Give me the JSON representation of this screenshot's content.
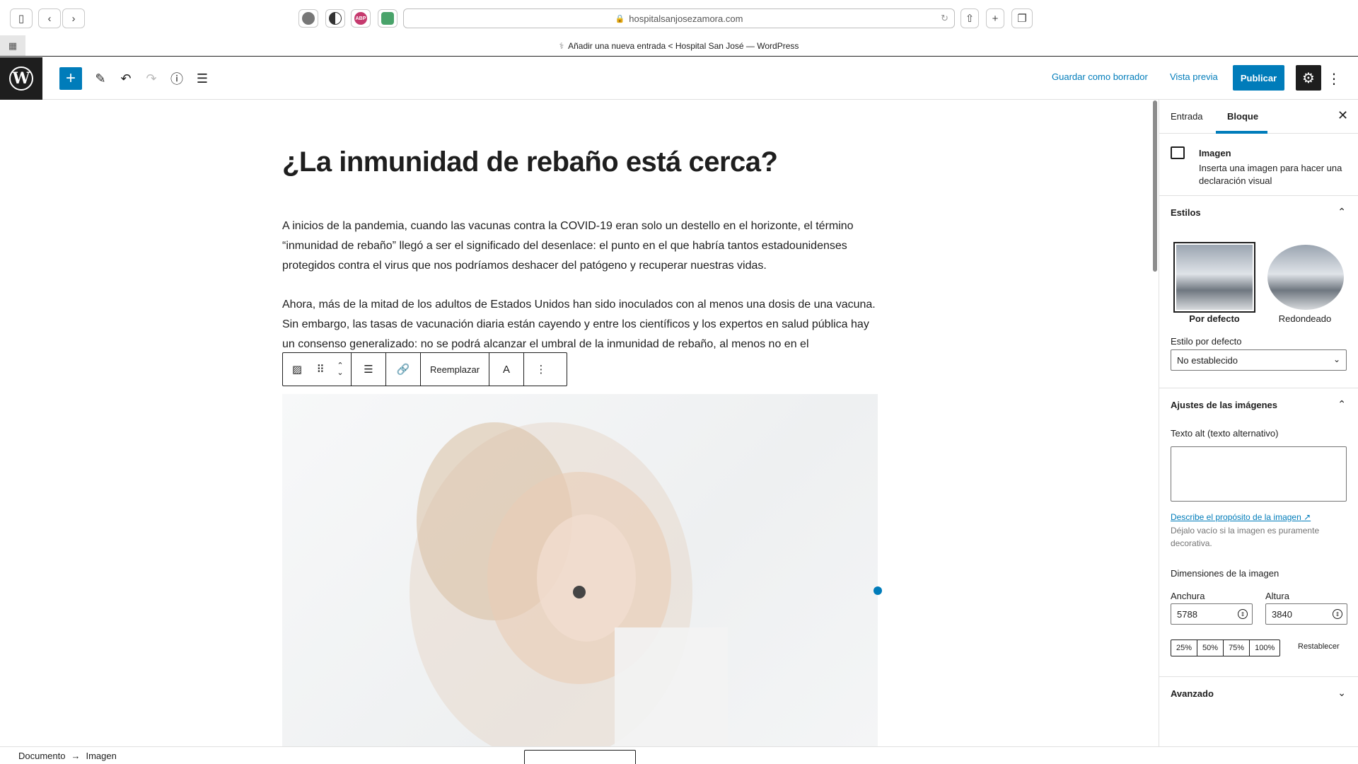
{
  "browser": {
    "url": "hospitalsanjosezamora.com",
    "tab_title": "Añadir una nueva entrada < Hospital San José — WordPress",
    "ext_abp_label": "ABP"
  },
  "header": {
    "save_draft": "Guardar como borrador",
    "preview": "Vista previa",
    "publish": "Publicar"
  },
  "post": {
    "title": "¿La inmunidad de rebaño está cerca?",
    "paragraph1": "A inicios de la pandemia, cuando las vacunas contra la COVID-19 eran solo un destello en el horizonte, el término “inmunidad de rebaño” llegó a ser el significado del desenlace: el punto en el que habría tantos estadounidenses protegidos contra el virus que nos podríamos deshacer del patógeno y recuperar nuestras vidas.",
    "paragraph2": "Ahora, más de la mitad de los adultos de Estados Unidos han sido inoculados con al menos una dosis de una vacuna. Sin embargo, las tasas de vacunación diaria están cayendo y entre los científicos y los expertos en salud pública hay un consenso generalizado: no se podrá alcanzar el umbral de la inmunidad de rebaño, al menos no en el"
  },
  "block_toolbar": {
    "replace": "Reemplazar",
    "text_letter": "A"
  },
  "sidebar": {
    "tab_post": "Entrada",
    "tab_block": "Bloque",
    "block_name": "Imagen",
    "block_desc": "Inserta una imagen para hacer una declaración visual",
    "styles_title": "Estilos",
    "style_default": "Por defecto",
    "style_rounded": "Redondeado",
    "default_style_label": "Estilo por defecto",
    "default_style_value": "No establecido",
    "image_settings_title": "Ajustes de las imágenes",
    "alt_label": "Texto alt (texto alternativo)",
    "alt_link": "Describe el propósito de la imagen",
    "alt_help": "Déjalo vacío si la imagen es puramente decorativa.",
    "dimensions_label": "Dimensiones de la imagen",
    "width_label": "Anchura",
    "height_label": "Altura",
    "width_value": "5788",
    "height_value": "3840",
    "pct": [
      "25%",
      "50%",
      "75%",
      "100%"
    ],
    "reset": "Restablecer",
    "advanced_title": "Avanzado"
  },
  "footer": {
    "crumb_document": "Documento",
    "crumb_image": "Imagen"
  },
  "colors": {
    "accent": "#007cba",
    "dark": "#1e1e1e"
  }
}
